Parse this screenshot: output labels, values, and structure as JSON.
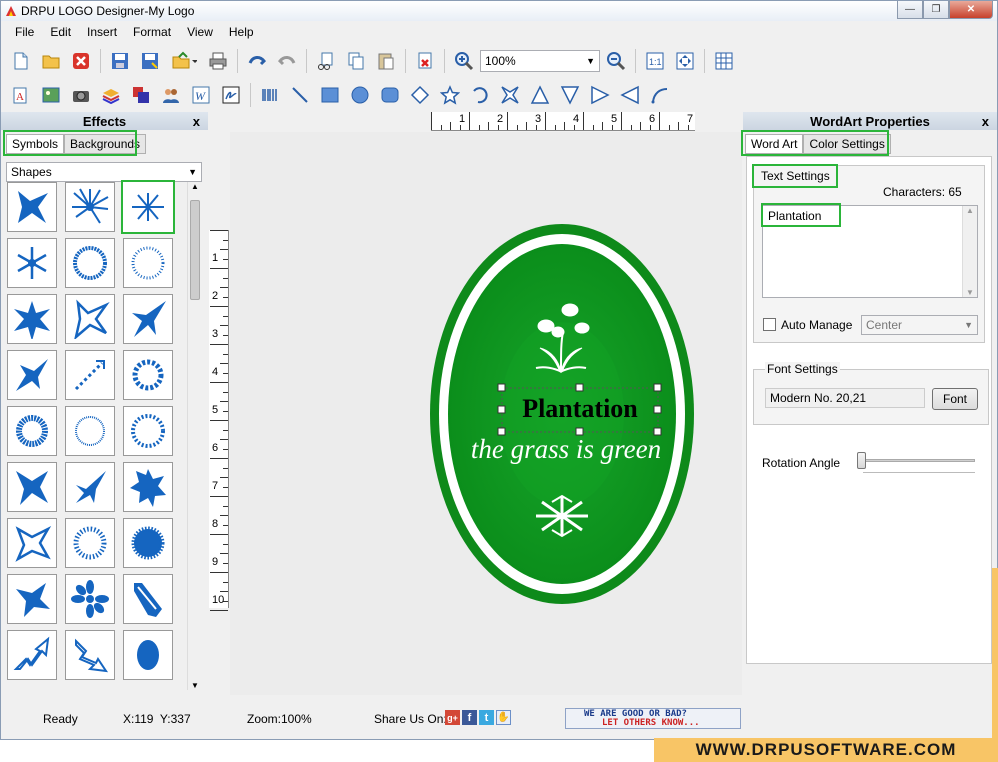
{
  "window": {
    "title": "DRPU LOGO Designer-My Logo"
  },
  "menu": [
    "File",
    "Edit",
    "Insert",
    "Format",
    "View",
    "Help"
  ],
  "toolbar": {
    "zoom_value": "100%"
  },
  "effects_panel": {
    "title": "Effects",
    "close": "x",
    "tabs": [
      "Symbols",
      "Backgrounds"
    ],
    "dropdown_value": "Shapes"
  },
  "ruler": {
    "h_numbers": [
      "1",
      "2",
      "3",
      "4",
      "5",
      "6",
      "7"
    ],
    "v_numbers": [
      "1",
      "2",
      "3",
      "4",
      "5",
      "6",
      "7",
      "8",
      "9",
      "10"
    ]
  },
  "logo": {
    "title": "Plantation",
    "tagline": "the grass is green",
    "colors": {
      "outer": "#0e8a1a",
      "ring": "#ffffff",
      "inner": "#0b8e1b",
      "glow": "#13a025"
    }
  },
  "wordart_panel": {
    "title": "WordArt Properties",
    "close": "x",
    "tabs": [
      "Word Art",
      "Color Settings"
    ],
    "text_settings_label": "Text Settings",
    "characters_label": "Characters: 65",
    "text_value": "Plantation",
    "auto_manage_label": "Auto Manage",
    "align_value": "Center",
    "font_settings_label": "Font Settings",
    "font_value": "Modern No. 20,21",
    "font_button": "Font",
    "rotation_label": "Rotation Angle"
  },
  "status": {
    "ready": "Ready",
    "coords": "X:119  Y:337",
    "zoom": "Zoom:100%",
    "share": "Share Us On:",
    "banner_line1": "WE ARE GOOD OR BAD?",
    "banner_line2": "LET OTHERS KNOW..."
  },
  "watermark": "WWW.DRPUSOFTWARE.COM",
  "icons": [
    "new-icon",
    "open-icon",
    "close-doc-icon",
    "save-icon",
    "save-as-icon",
    "export-icon",
    "print-icon",
    "undo-icon",
    "redo-icon",
    "cut-icon",
    "copy-icon",
    "paste-icon",
    "delete-icon",
    "zoom-in-icon",
    "zoom-out-icon",
    "actual-size-icon",
    "fit-icon",
    "grid-icon"
  ],
  "accent_color": "#2bb53a",
  "shape_color": "#1565c0"
}
